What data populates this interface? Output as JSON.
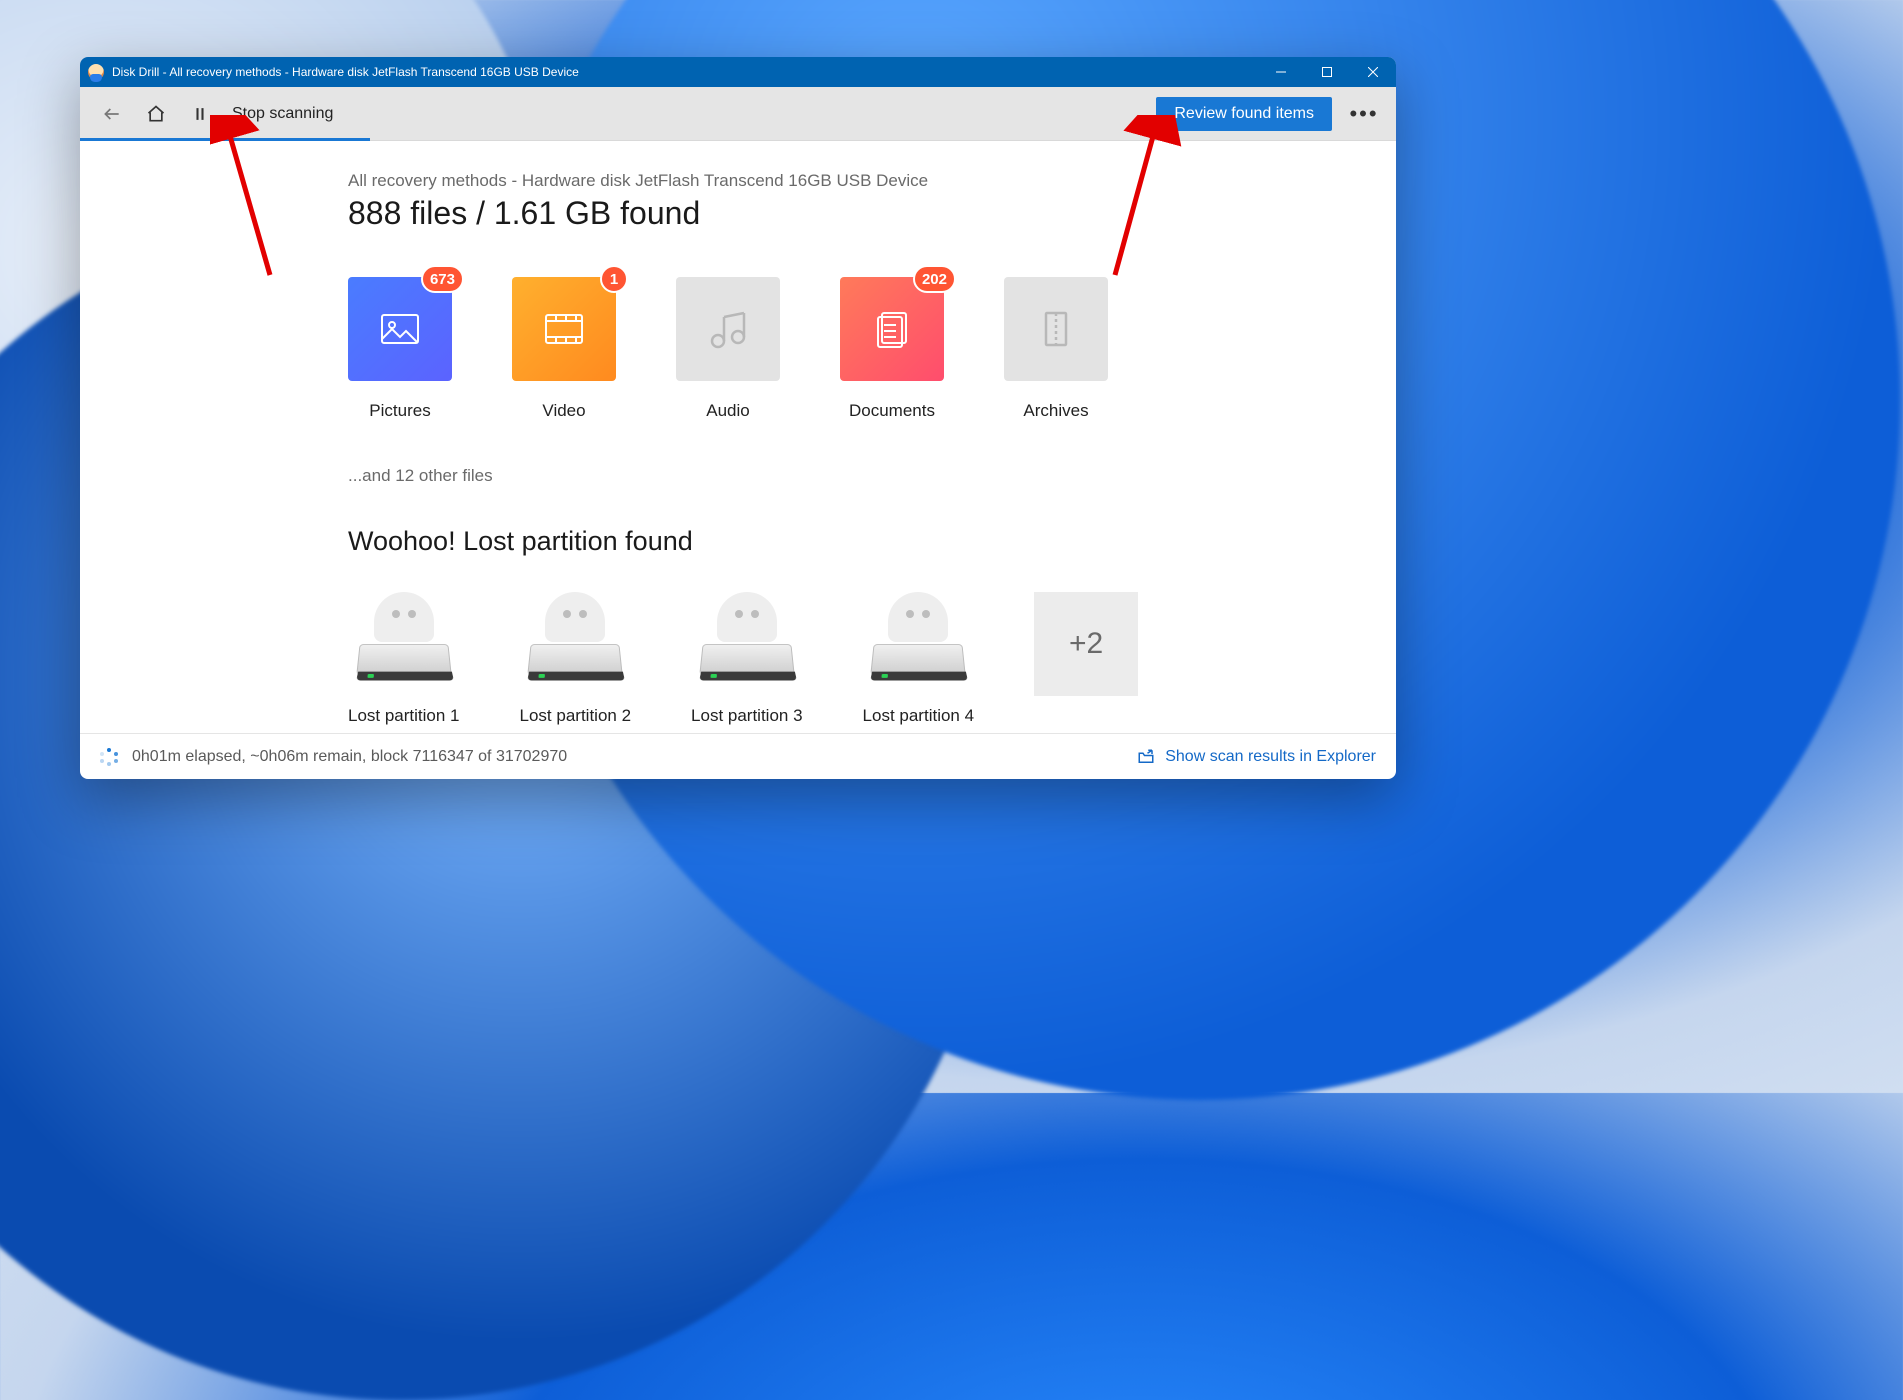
{
  "titlebar": {
    "title": "Disk Drill - All recovery methods - Hardware disk JetFlash Transcend 16GB USB Device"
  },
  "toolbar": {
    "stop_label": "Stop scanning",
    "review_label": "Review found items"
  },
  "main": {
    "subtitle": "All recovery methods - Hardware disk JetFlash Transcend 16GB USB Device",
    "summary": "888 files / 1.61 GB found",
    "other_files": "...and 12 other files",
    "partition_heading": "Woohoo! Lost partition found"
  },
  "categories": [
    {
      "label": "Pictures",
      "badge": "673"
    },
    {
      "label": "Video",
      "badge": "1"
    },
    {
      "label": "Audio",
      "badge": null
    },
    {
      "label": "Documents",
      "badge": "202"
    },
    {
      "label": "Archives",
      "badge": null
    }
  ],
  "partitions": [
    {
      "label": "Lost partition 1"
    },
    {
      "label": "Lost partition 2"
    },
    {
      "label": "Lost partition 3"
    },
    {
      "label": "Lost partition 4"
    }
  ],
  "more_partitions_label": "+2",
  "status": {
    "text": "0h01m elapsed, ~0h06m remain, block 7116347 of 31702970",
    "explorer_link": "Show scan results in Explorer"
  },
  "colors": {
    "accent": "#1978d4",
    "badge": "#ff5533"
  }
}
